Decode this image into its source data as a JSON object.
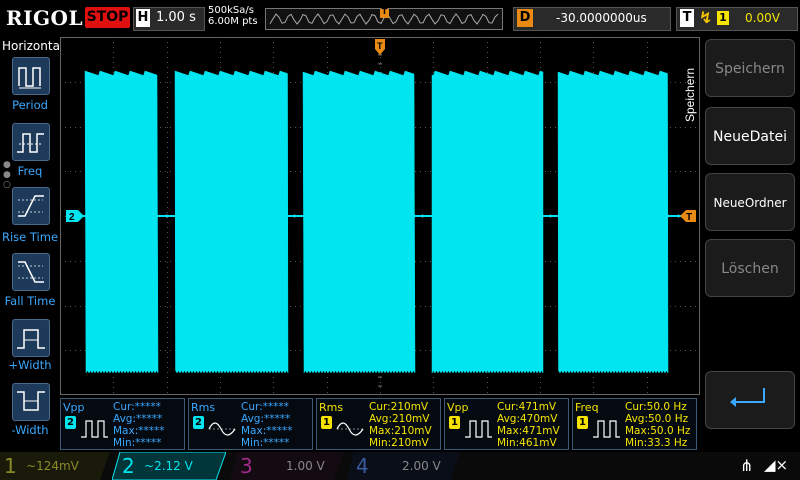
{
  "topbar": {
    "logo": "RIGOL",
    "run_state": "STOP",
    "horizontal_label": "H",
    "timebase": "1.00 s",
    "sample_rate": "500kSa/s",
    "memory_depth": "6.00M pts",
    "trigger_marker": "T",
    "delay_label": "D",
    "delay_value": "-30.0000000us",
    "trigger_label": "T",
    "trigger_edge": "rising-edge-icon",
    "trigger_source": "1",
    "trigger_level": "0.00V"
  },
  "left_menu": {
    "title": "Horizontal",
    "items": [
      {
        "label": "Period",
        "icon": "period-icon"
      },
      {
        "label": "Freq",
        "icon": "freq-icon"
      },
      {
        "label": "Rise Time",
        "icon": "rise-time-icon"
      },
      {
        "label": "Fall Time",
        "icon": "fall-time-icon"
      },
      {
        "label": "+Width",
        "icon": "positive-width-icon"
      },
      {
        "label": "-Width",
        "icon": "negative-width-icon"
      }
    ]
  },
  "right_menu": {
    "title": "Speichern",
    "buttons": [
      {
        "label": "Speichern",
        "enabled": false
      },
      {
        "label": "NeueDatei",
        "enabled": true
      },
      {
        "label": "NeueOrdner",
        "enabled": true
      },
      {
        "label": "Löschen",
        "enabled": false
      },
      {
        "label": "",
        "icon": "return-arrow-icon",
        "enabled": true
      }
    ]
  },
  "waveform": {
    "color": "#00e5f0",
    "channel_marker": "2",
    "trigger_level_marker": "T",
    "top_marker": "T"
  },
  "measurements": [
    {
      "name": "Vpp",
      "channel": "2",
      "cur": "Cur:*****",
      "avg": "Avg:*****",
      "max": "Max:*****",
      "min": "Min:*****",
      "highlight": false
    },
    {
      "name": "Rms",
      "channel": "2",
      "cur": "Cur:*****",
      "avg": "Avg:*****",
      "max": "Max:*****",
      "min": "Min:*****",
      "highlight": false
    },
    {
      "name": "Rms",
      "channel": "1",
      "cur": "Cur:210mV",
      "avg": "Avg:210mV",
      "max": "Max:210mV",
      "min": "Min:210mV",
      "highlight": true
    },
    {
      "name": "Vpp",
      "channel": "1",
      "cur": "Cur:471mV",
      "avg": "Avg:470mV",
      "max": "Max:471mV",
      "min": "Min:461mV",
      "highlight": true
    },
    {
      "name": "Freq",
      "channel": "1",
      "cur": "Cur:50.0 Hz",
      "avg": "Avg:50.0 Hz",
      "max": "Max:50.0 Hz",
      "min": "Min:33.3 Hz",
      "highlight": true
    }
  ],
  "channels": [
    {
      "num": "1",
      "value": "124mV",
      "coupling": "~",
      "color": "#8a8a2a",
      "active": false
    },
    {
      "num": "2",
      "value": "2.12 V",
      "coupling": "~",
      "color": "#00e5f0",
      "active": true
    },
    {
      "num": "3",
      "value": "1.00 V",
      "coupling": "",
      "color": "#a02a8a",
      "active": false
    },
    {
      "num": "4",
      "value": "2.00 V",
      "coupling": "",
      "color": "#3a5aa0",
      "active": false
    }
  ],
  "status": {
    "usb_icon": "usb-icon",
    "mute_icon": "speaker-mute-icon"
  }
}
